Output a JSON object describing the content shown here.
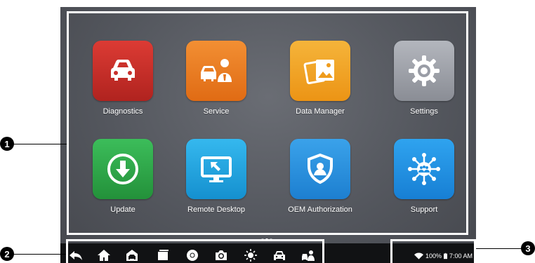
{
  "apps": [
    {
      "label": "Diagnostics",
      "icon": "car-icon",
      "color": "#c9302c"
    },
    {
      "label": "Service",
      "icon": "mechanic-icon",
      "color": "#ee7c22"
    },
    {
      "label": "Data Manager",
      "icon": "photos-icon",
      "color": "#f0a51f"
    },
    {
      "label": "Settings",
      "icon": "gear-icon",
      "color": "#9a9da6"
    },
    {
      "label": "Update",
      "icon": "download-icon",
      "color": "#2ea64a"
    },
    {
      "label": "Remote Desktop",
      "icon": "monitor-icon",
      "color": "#1fa6e0"
    },
    {
      "label": "OEM Authorization",
      "icon": "shield-user-icon",
      "color": "#2790de"
    },
    {
      "label": "Support",
      "icon": "network-icon",
      "color": "#1f8fe0"
    }
  ],
  "navbar": {
    "icons": [
      "back-icon",
      "home-icon",
      "car-home-icon",
      "recent-apps-icon",
      "browser-icon",
      "camera-icon",
      "brightness-icon",
      "vci-car-icon",
      "mechanic-icon"
    ]
  },
  "status": {
    "battery": "100%",
    "time": "7:00 AM"
  },
  "callouts": [
    "1",
    "2",
    "3"
  ]
}
